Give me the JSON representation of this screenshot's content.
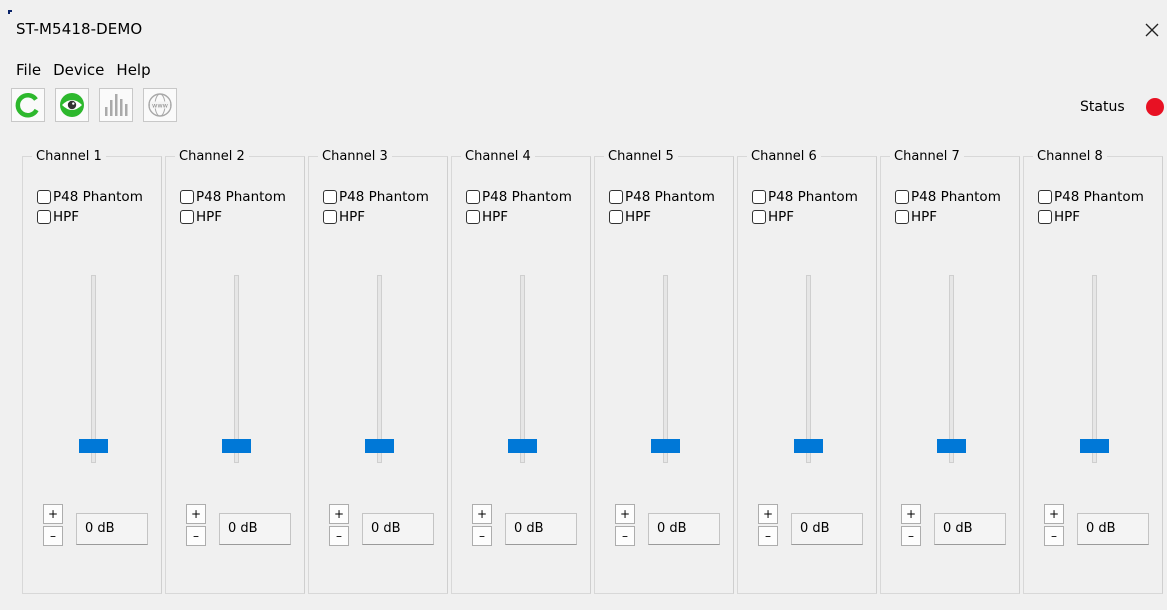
{
  "window": {
    "title": "ST-M5418-DEMO"
  },
  "menu": [
    "File",
    "Device",
    "Help"
  ],
  "toolbar": {
    "buttons": [
      "refresh-icon",
      "eye-icon",
      "level-meter-icon",
      "web-icon"
    ],
    "status_label": "Status",
    "status_color": "#e81123"
  },
  "colors": {
    "accent": "#0078d7",
    "refresh": "#2db82d"
  },
  "channels": [
    {
      "title": "Channel 1",
      "phantom_label": "P48 Phantom",
      "hpf_label": "HPF",
      "phantom_checked": false,
      "hpf_checked": false,
      "plus": "+",
      "minus": "–",
      "gain": "0 dB",
      "fader_level": 0.09
    },
    {
      "title": "Channel 2",
      "phantom_label": "P48 Phantom",
      "hpf_label": "HPF",
      "phantom_checked": false,
      "hpf_checked": false,
      "plus": "+",
      "minus": "–",
      "gain": "0 dB",
      "fader_level": 0.09
    },
    {
      "title": "Channel 3",
      "phantom_label": "P48 Phantom",
      "hpf_label": "HPF",
      "phantom_checked": false,
      "hpf_checked": false,
      "plus": "+",
      "minus": "–",
      "gain": "0 dB",
      "fader_level": 0.09
    },
    {
      "title": "Channel 4",
      "phantom_label": "P48 Phantom",
      "hpf_label": "HPF",
      "phantom_checked": false,
      "hpf_checked": false,
      "plus": "+",
      "minus": "–",
      "gain": "0 dB",
      "fader_level": 0.09
    },
    {
      "title": "Channel 5",
      "phantom_label": "P48 Phantom",
      "hpf_label": "HPF",
      "phantom_checked": false,
      "hpf_checked": false,
      "plus": "+",
      "minus": "–",
      "gain": "0 dB",
      "fader_level": 0.09
    },
    {
      "title": "Channel 6",
      "phantom_label": "P48 Phantom",
      "hpf_label": "HPF",
      "phantom_checked": false,
      "hpf_checked": false,
      "plus": "+",
      "minus": "–",
      "gain": "0 dB",
      "fader_level": 0.09
    },
    {
      "title": "Channel 7",
      "phantom_label": "P48 Phantom",
      "hpf_label": "HPF",
      "phantom_checked": false,
      "hpf_checked": false,
      "plus": "+",
      "minus": "–",
      "gain": "0 dB",
      "fader_level": 0.09
    },
    {
      "title": "Channel 8",
      "phantom_label": "P48 Phantom",
      "hpf_label": "HPF",
      "phantom_checked": false,
      "hpf_checked": false,
      "plus": "+",
      "minus": "–",
      "gain": "0 dB",
      "fader_level": 0.09
    }
  ]
}
